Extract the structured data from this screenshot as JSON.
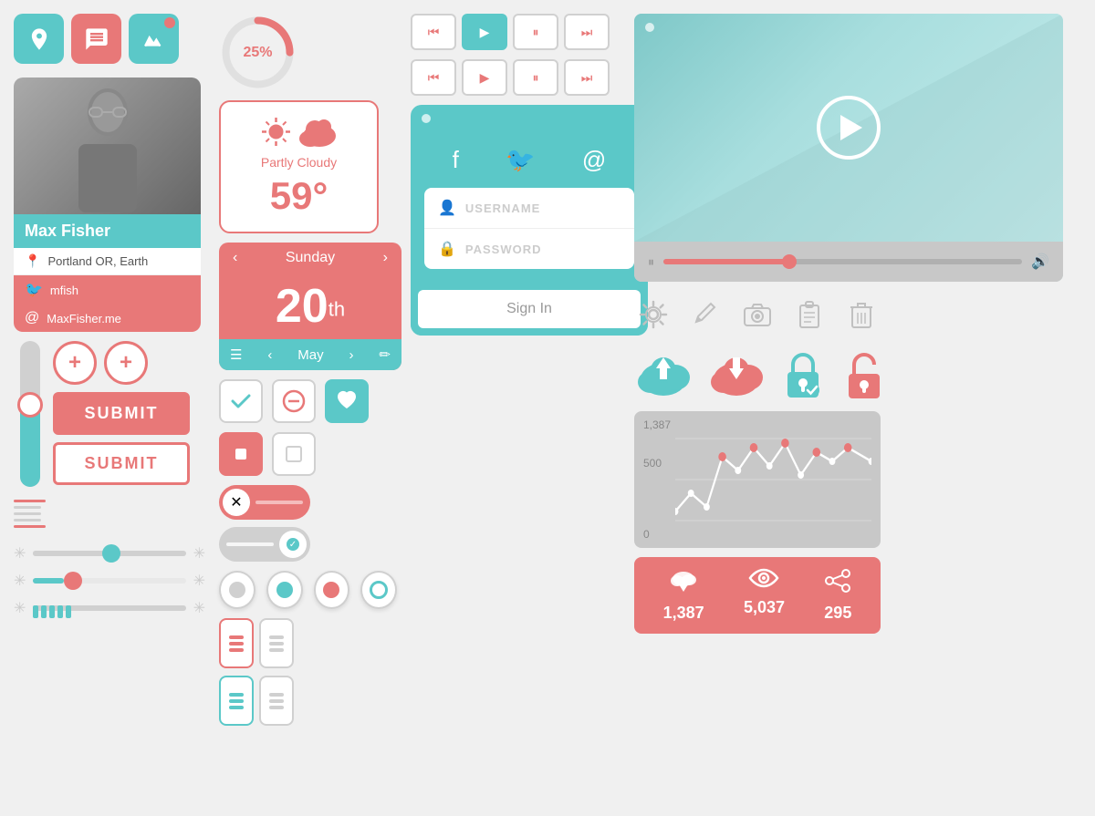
{
  "profile": {
    "name": "Max Fisher",
    "location": "Portland OR, Earth",
    "twitter": "mfish",
    "website": "MaxFisher.me"
  },
  "weather": {
    "condition": "Partly Cloudy",
    "temperature": "59",
    "unit": "°"
  },
  "calendar": {
    "day_name": "Sunday",
    "day_num": "20",
    "day_suffix": "th",
    "month": "May"
  },
  "progress": {
    "value": 25,
    "label": "25%"
  },
  "buttons": {
    "submit": "SUBMIT"
  },
  "login": {
    "username_placeholder": "USERNAME",
    "password_placeholder": "PASSWORD",
    "sign_in": "Sign In"
  },
  "stats": {
    "value1": "1,387",
    "value2": "5,037",
    "value3": "295",
    "chart_high": "1,387",
    "chart_mid": "500",
    "chart_low": "0"
  },
  "media": {
    "prev_prev": "⏮",
    "play": "▶",
    "pause": "⏸",
    "next_next": "⏭",
    "prev": "⏮",
    "play2": "▶",
    "pause2": "⏸",
    "next": "⏭"
  },
  "icons": {
    "location": "📍",
    "chat": "💬",
    "activity": "📈",
    "gear": "⚙",
    "pencil": "✏",
    "camera": "📷",
    "clipboard": "📋",
    "trash": "🗑",
    "upload_cloud": "☁",
    "download_cloud": "☁",
    "lock": "🔒",
    "unlock": "🔓"
  }
}
